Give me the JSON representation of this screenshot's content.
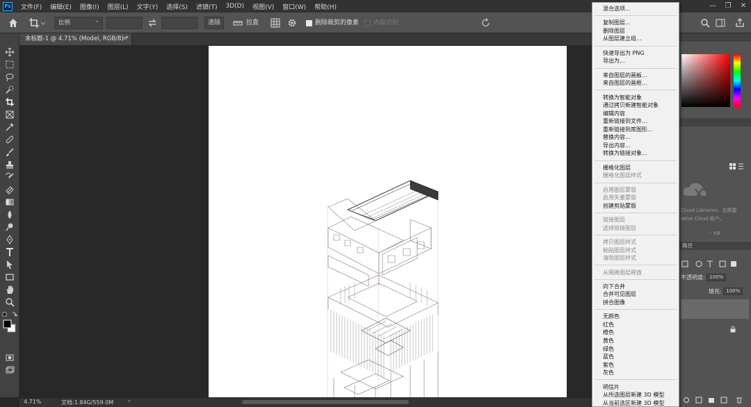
{
  "menubar": {
    "logo": "Ps",
    "items": [
      "文件(F)",
      "编辑(E)",
      "图像(I)",
      "图层(L)",
      "文字(Y)",
      "选择(S)",
      "滤镜(T)",
      "3D(D)",
      "视图(V)",
      "窗口(W)",
      "帮助(H)"
    ],
    "window_controls": [
      "—",
      "❐",
      "✕"
    ]
  },
  "options": {
    "ratio_value": "比例",
    "clear_label": "清除",
    "straighten_label": "拉直",
    "delete_cropped_label": "删除裁剪的像素",
    "delete_cropped_checked": true,
    "content_aware_label": "内容识别",
    "content_aware_checked": false
  },
  "document": {
    "tab_title": "未标题-1 @ 4.71% (Model, RGB/8) *",
    "close_glyph": "×"
  },
  "status": {
    "zoom": "4.71%",
    "doc_size": "文档:1.84G/559.0M",
    "arrow": "›"
  },
  "panels": {
    "libraries_text_1": "Cloud Libraries。怎需要",
    "libraries_text_2": "ative Cloud 帐户。",
    "kb": "-- KB",
    "layers_tab": "路径",
    "opacity_label": "不透明度:",
    "opacity_value": "100%",
    "fill_label": "填充:",
    "fill_value": "100%"
  },
  "context_menu": {
    "groups": [
      [
        {
          "label": "混合选项...",
          "enabled": true
        }
      ],
      [
        {
          "label": "复制图层...",
          "enabled": true
        },
        {
          "label": "删除图层",
          "enabled": true
        },
        {
          "label": "从图层建立组...",
          "enabled": true
        }
      ],
      [
        {
          "label": "快速导出为 PNG",
          "enabled": true
        },
        {
          "label": "导出为...",
          "enabled": true
        }
      ],
      [
        {
          "label": "来自图层的画板...",
          "enabled": true
        },
        {
          "label": "来自图层的画框...",
          "enabled": true
        }
      ],
      [
        {
          "label": "转换为智能对象",
          "enabled": true
        },
        {
          "label": "通过拷贝新建智能对象",
          "enabled": true
        },
        {
          "label": "编辑内容",
          "enabled": true
        },
        {
          "label": "重新链接到文件...",
          "enabled": true
        },
        {
          "label": "重新链接到库图形...",
          "enabled": true
        },
        {
          "label": "替换内容...",
          "enabled": true
        },
        {
          "label": "导出内容...",
          "enabled": true
        },
        {
          "label": "转换为链接对象...",
          "enabled": true
        }
      ],
      [
        {
          "label": "栅格化图层",
          "enabled": true
        },
        {
          "label": "栅格化图层样式",
          "enabled": false
        }
      ],
      [
        {
          "label": "启用图层蒙版",
          "enabled": false
        },
        {
          "label": "启用矢量蒙版",
          "enabled": false
        },
        {
          "label": "创建剪贴蒙版",
          "enabled": true
        }
      ],
      [
        {
          "label": "链接图层",
          "enabled": false
        },
        {
          "label": "选择链接图层",
          "enabled": false
        }
      ],
      [
        {
          "label": "拷贝图层样式",
          "enabled": false
        },
        {
          "label": "粘贴图层样式",
          "enabled": false
        },
        {
          "label": "清除图层样式",
          "enabled": false
        }
      ],
      [
        {
          "label": "从隔离图层释放",
          "enabled": false
        }
      ],
      [
        {
          "label": "向下合并",
          "enabled": true
        },
        {
          "label": "合并可见图层",
          "enabled": true
        },
        {
          "label": "拼合图像",
          "enabled": true
        }
      ],
      [
        {
          "label": "无颜色",
          "enabled": true
        },
        {
          "label": "红色",
          "enabled": true
        },
        {
          "label": "橙色",
          "enabled": true
        },
        {
          "label": "黄色",
          "enabled": true
        },
        {
          "label": "绿色",
          "enabled": true
        },
        {
          "label": "蓝色",
          "enabled": true
        },
        {
          "label": "紫色",
          "enabled": true
        },
        {
          "label": "灰色",
          "enabled": true
        }
      ],
      [
        {
          "label": "明信片",
          "enabled": true
        },
        {
          "label": "从所选图层新建 3D 模型",
          "enabled": true
        },
        {
          "label": "从当前选区新建 3D 模型",
          "enabled": true
        }
      ]
    ]
  },
  "colors": {
    "menubar_bg": "#323232",
    "options_bg": "#535353",
    "canvas_bg": "#282828",
    "menu_bg": "#f1f1f1",
    "accent": "#31a8ff"
  }
}
